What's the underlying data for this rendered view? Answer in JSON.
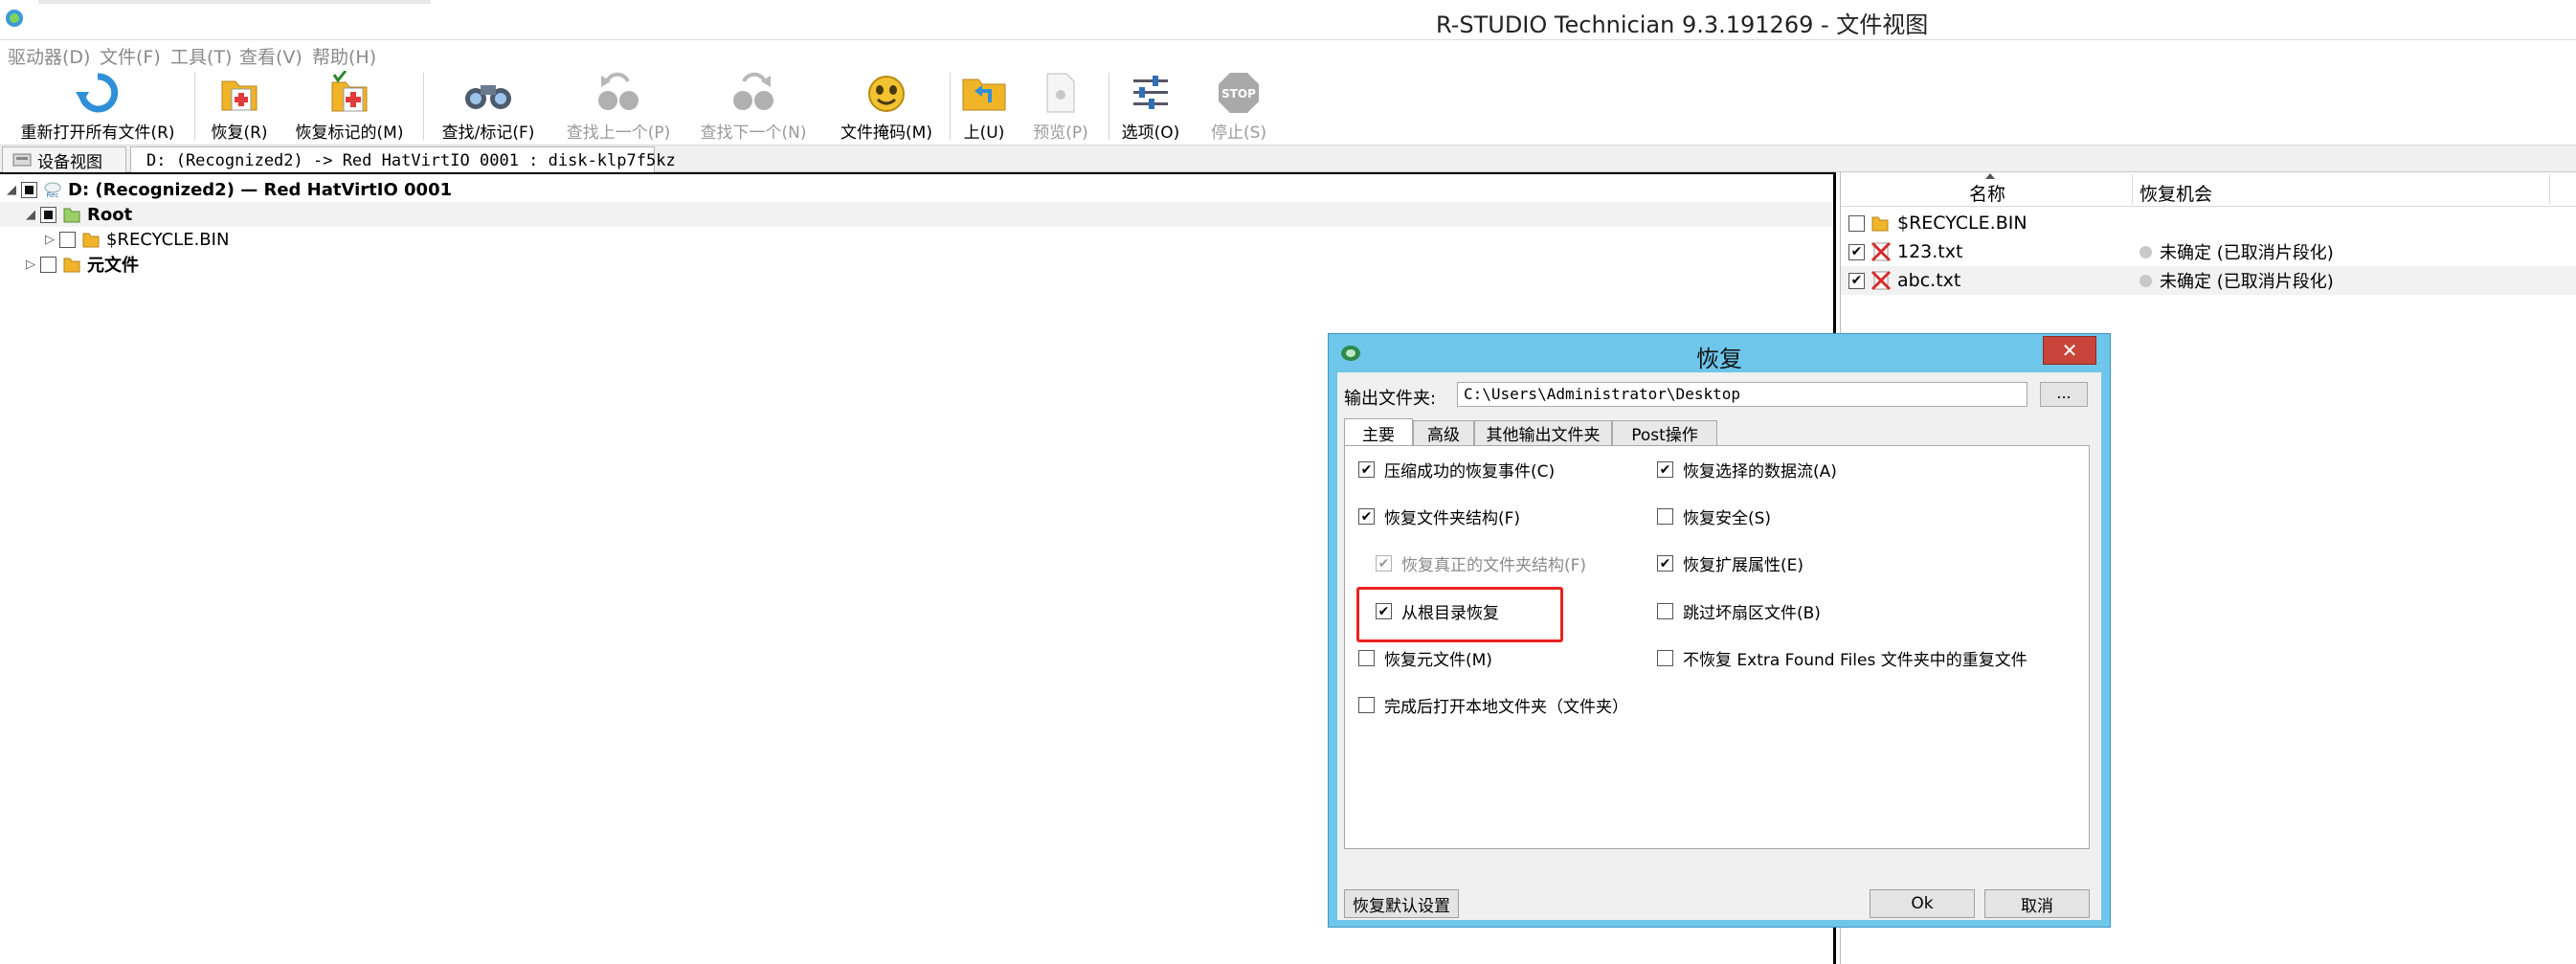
{
  "window": {
    "title": "R-STUDIO Technician 9.3.191269 - 文件视图"
  },
  "menu": [
    {
      "label": "驱动器(D)"
    },
    {
      "label": "文件(F)"
    },
    {
      "label": "工具(T)"
    },
    {
      "label": "查看(V)"
    },
    {
      "label": "帮助(H)"
    }
  ],
  "toolbar": [
    {
      "label": "重新打开所有文件(R)",
      "icon": "reopen-icon",
      "enabled": true
    },
    {
      "label": "恢复(R)",
      "icon": "recover-icon",
      "enabled": true
    },
    {
      "label": "恢复标记的(M)",
      "icon": "recover-marked-icon",
      "enabled": true
    },
    {
      "label": "查找/标记(F)",
      "icon": "binoculars-icon",
      "enabled": true
    },
    {
      "label": "查找上一个(P)",
      "icon": "find-previous-icon",
      "enabled": false
    },
    {
      "label": "查找下一个(N)",
      "icon": "find-next-icon",
      "enabled": false
    },
    {
      "label": "文件掩码(M)",
      "icon": "file-mask-icon",
      "enabled": true
    },
    {
      "label": "上(U)",
      "icon": "folder-up-icon",
      "enabled": true
    },
    {
      "label": "预览(P)",
      "icon": "preview-icon",
      "enabled": false
    },
    {
      "label": "选项(O)",
      "icon": "options-icon",
      "enabled": true
    },
    {
      "label": "停止(S)",
      "icon": "stop-icon",
      "enabled": false
    }
  ],
  "tabs": [
    {
      "label": "设备视图"
    },
    {
      "label": "D: (Recognized2) -> Red HatVirtIO 0001 : disk-klp7f5kz"
    }
  ],
  "tree": [
    {
      "label": "D: (Recognized2) — Red HatVirtIO 0001",
      "icon_text": "Rec"
    },
    {
      "label": "Root"
    },
    {
      "label": "$RECYCLE.BIN"
    },
    {
      "label": "元文件"
    }
  ],
  "list": {
    "columns": [
      "名称",
      "恢复机会"
    ],
    "rows": [
      {
        "name": "$RECYCLE.BIN",
        "chance": "",
        "checked": false
      },
      {
        "name": "123.txt",
        "chance": "未确定 (已取消片段化)",
        "checked": true
      },
      {
        "name": "abc.txt",
        "chance": "未确定 (已取消片段化)",
        "checked": true
      }
    ]
  },
  "dialog": {
    "title": "恢复",
    "close_label": "✕",
    "output_label": "输出文件夹:",
    "output_value": "C:\\Users\\Administrator\\Desktop",
    "browse_label": "...",
    "tabs": [
      "主要",
      "高级",
      "其他输出文件夹",
      "Post操作"
    ],
    "options": [
      {
        "label": "压缩成功的恢复事件(C)",
        "checked": true,
        "enabled": true
      },
      {
        "label": "恢复选择的数据流(A)",
        "checked": true,
        "enabled": true
      },
      {
        "label": "恢复文件夹结构(F)",
        "checked": true,
        "enabled": true
      },
      {
        "label": "恢复安全(S)",
        "checked": false,
        "enabled": true
      },
      {
        "label": "恢复真正的文件夹结构(F)",
        "checked": true,
        "enabled": false
      },
      {
        "label": "恢复扩展属性(E)",
        "checked": true,
        "enabled": true
      },
      {
        "label": "从根目录恢复",
        "checked": true,
        "enabled": true
      },
      {
        "label": "跳过坏扇区文件(B)",
        "checked": false,
        "enabled": true
      },
      {
        "label": "恢复元文件(M)",
        "checked": false,
        "enabled": true
      },
      {
        "label": "不恢复 Extra Found Files 文件夹中的重复文件",
        "checked": false,
        "enabled": true
      },
      {
        "label": "完成后打开本地文件夹（文件夹）",
        "checked": false,
        "enabled": true
      }
    ],
    "reset_label": "恢复默认设置",
    "ok_label": "Ok",
    "cancel_label": "取消"
  },
  "colors": {
    "dialog_frame": "#6ec6ea",
    "close_button": "#c9443a",
    "highlight": "#e8231f",
    "folder": "#f0b429"
  }
}
